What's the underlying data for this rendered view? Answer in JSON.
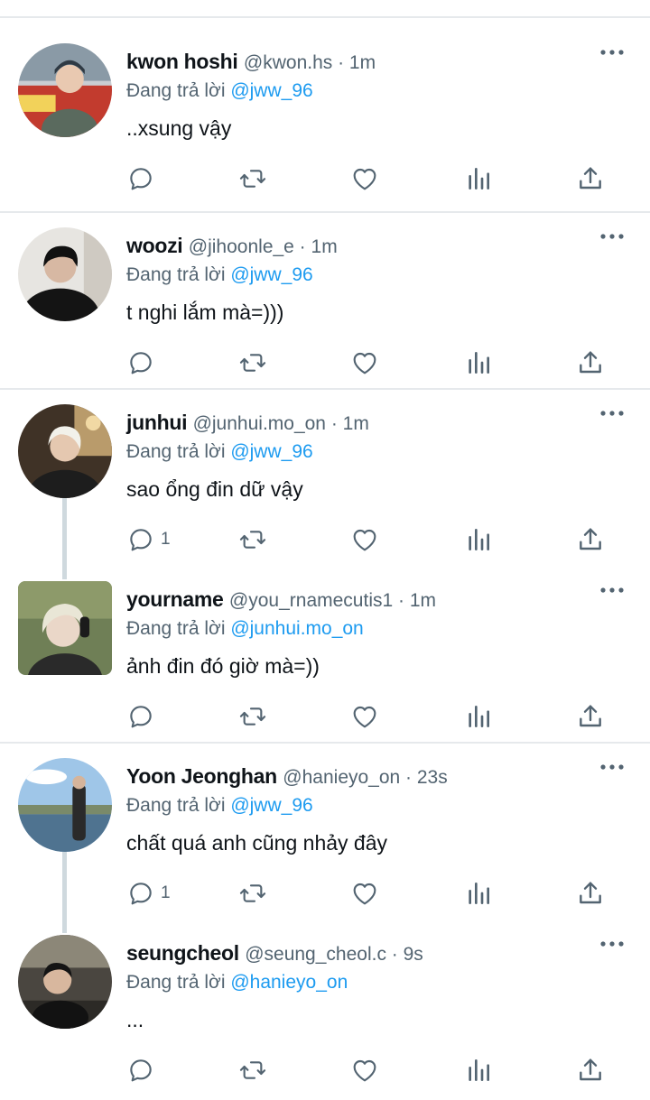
{
  "ui": {
    "accent": "#1d9bf0",
    "muted": "#536471",
    "divider": "#e6e9ec",
    "thread_line": "#cfd9de"
  },
  "tweets": [
    {
      "name": "kwon hoshi",
      "meta": "@kwon.hs · 1m",
      "reply_prefix": "Đang trả lời",
      "reply_to": "@jww_96",
      "text": "..xsung vậy",
      "reply_count": "",
      "avatar_icon": "avatar-photo"
    },
    {
      "name": "woozi",
      "meta": "@jihoonle_e · 1m",
      "reply_prefix": "Đang trả lời",
      "reply_to": "@jww_96",
      "text": "t nghi lắm mà=)))",
      "reply_count": "",
      "avatar_icon": "avatar-photo"
    },
    {
      "name": "junhui",
      "meta": "@junhui.mo_on · 1m",
      "reply_prefix": "Đang trả lời",
      "reply_to": "@jww_96",
      "text": "sao ổng đin dữ vậy",
      "reply_count": "1",
      "avatar_icon": "avatar-photo"
    },
    {
      "name": "yourname",
      "meta": "@you_rnamecutis1 · 1m",
      "reply_prefix": "Đang trả lời",
      "reply_to": "@junhui.mo_on",
      "text": "ảnh đin đó giờ mà=))",
      "reply_count": "",
      "avatar_icon": "avatar-photo"
    },
    {
      "name": "Yoon Jeonghan",
      "meta": "@hanieyo_on · 23s",
      "reply_prefix": "Đang trả lời",
      "reply_to": "@jww_96",
      "text": "chất quá anh cũng nhảy đây",
      "reply_count": "1",
      "avatar_icon": "avatar-photo"
    },
    {
      "name": "seungcheol",
      "meta": "@seung_cheol.c · 9s",
      "reply_prefix": "Đang trả lời",
      "reply_to": "@hanieyo_on",
      "text": "...",
      "reply_count": "",
      "avatar_icon": "avatar-photo"
    }
  ]
}
